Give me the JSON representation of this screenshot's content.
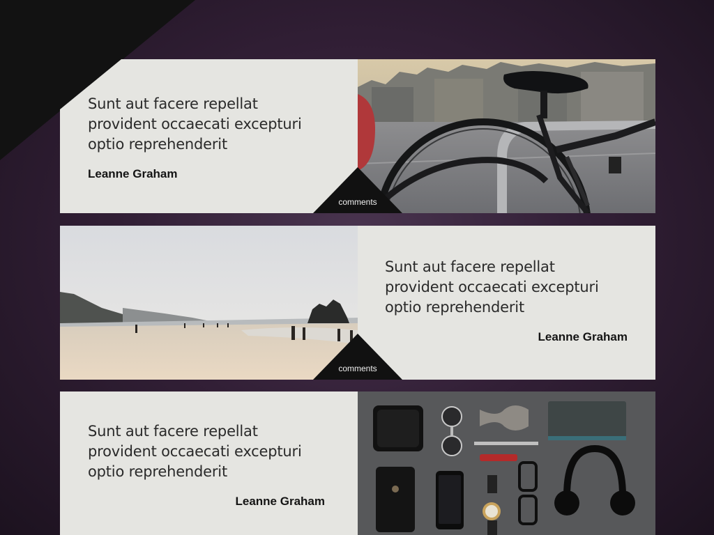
{
  "posts": [
    {
      "title_line1": "Sunt aut facere repellat",
      "title_line2": "provident occaecati excepturi",
      "title_line3": "optio reprehenderit",
      "author": "Leanne Graham",
      "comments_label": "comments",
      "image": "bicycle-photo"
    },
    {
      "title_line1": "Sunt aut facere repellat",
      "title_line2": "provident occaecati excepturi",
      "title_line3": "optio reprehenderit",
      "author": "Leanne Graham",
      "comments_label": "comments",
      "image": "beach-photo"
    },
    {
      "title_line1": "Sunt aut facere repellat",
      "title_line2": "provident occaecati excepturi",
      "title_line3": "optio reprehenderit",
      "author": "Leanne Graham",
      "image": "accessories-photo"
    }
  ],
  "colors": {
    "background": "#3a2640",
    "card": "#e5e5e1",
    "title": "#2a2a2a",
    "badge": "#111111",
    "corner": "#121212"
  }
}
